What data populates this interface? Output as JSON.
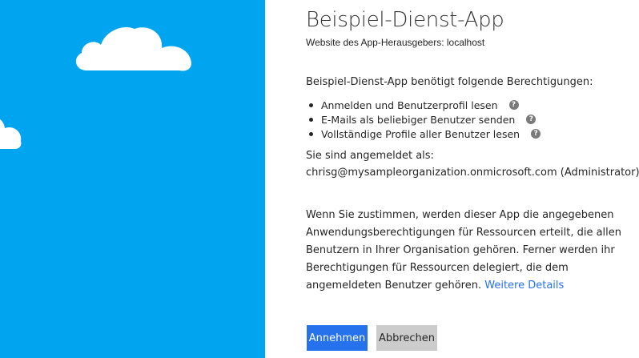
{
  "app": {
    "title": "Beispiel-Dienst-App",
    "publisher_site": "Website des App-Herausgebers: localhost"
  },
  "permissions": {
    "heading": "Beispiel-Dienst-App benötigt folgende Berechtigungen:",
    "items": [
      {
        "label": "Anmelden und Benutzerprofil lesen",
        "help_icon": "?"
      },
      {
        "label": "E-Mails als beliebiger Benutzer senden",
        "help_icon": "?"
      },
      {
        "label": "Vollständige Profile aller Benutzer lesen",
        "help_icon": "?"
      }
    ]
  },
  "account": {
    "signed_in_label": "Sie sind angemeldet als:",
    "identity": "chrisg@mysampleorganization.onmicrosoft.com (Administrator)"
  },
  "consent": {
    "text": "Wenn Sie zustimmen, werden dieser App die angegebenen Anwendungsberechtigungen für Ressourcen erteilt, die allen Benutzern in Ihrer Organisation gehören. Ferner werden ihr Berechtigungen für Ressourcen delegiert, die dem angemeldeten Benutzer gehören.",
    "more_details_link": "Weitere Details"
  },
  "buttons": {
    "accept_label": "Annehmen",
    "cancel_label": "Abbrechen"
  },
  "colors": {
    "left_panel": "#00a4ef",
    "accent": "#2672ec",
    "cancel_button": "#cccccc"
  },
  "icons": {
    "cloud": "cloud-icon",
    "help": "help-icon"
  }
}
